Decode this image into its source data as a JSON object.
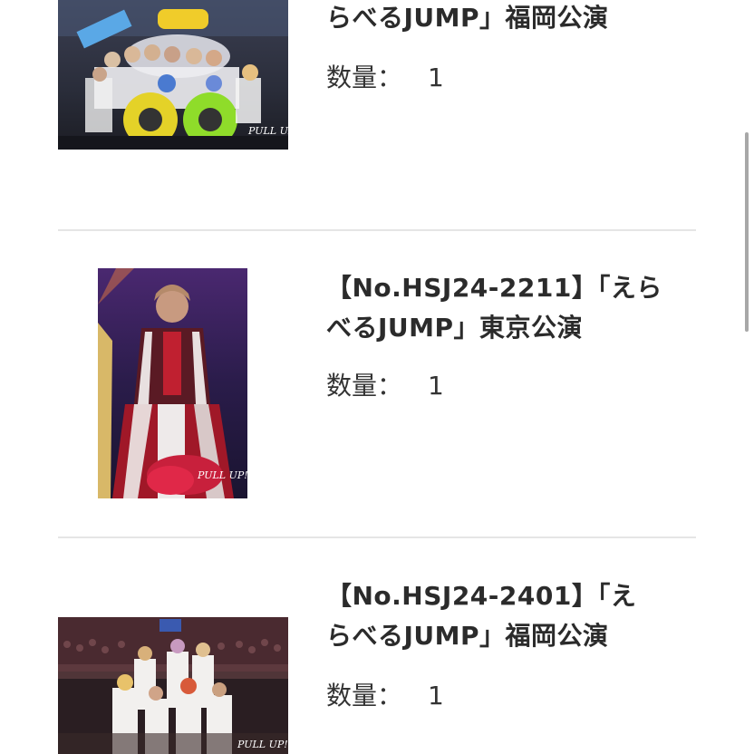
{
  "items": [
    {
      "title_line1": "",
      "title_line2": "らべるJUMP」福岡公演",
      "qty_label": "数量：",
      "qty_value": "1"
    },
    {
      "title_line1": "【No.HSJ24-2211】「えら",
      "title_line2": "べるJUMP」東京公演",
      "qty_label": "数量：",
      "qty_value": "1"
    },
    {
      "title_line1": "【No.HSJ24-2401】「え",
      "title_line2": "らべるJUMP」福岡公演",
      "qty_label": "数量：",
      "qty_value": "1"
    }
  ],
  "photo_logo_text": "PULL UP!",
  "colors": {
    "divider": "#e5e5e5",
    "scrollbar": "#a8a8a8",
    "text": "#2b2b2b"
  }
}
